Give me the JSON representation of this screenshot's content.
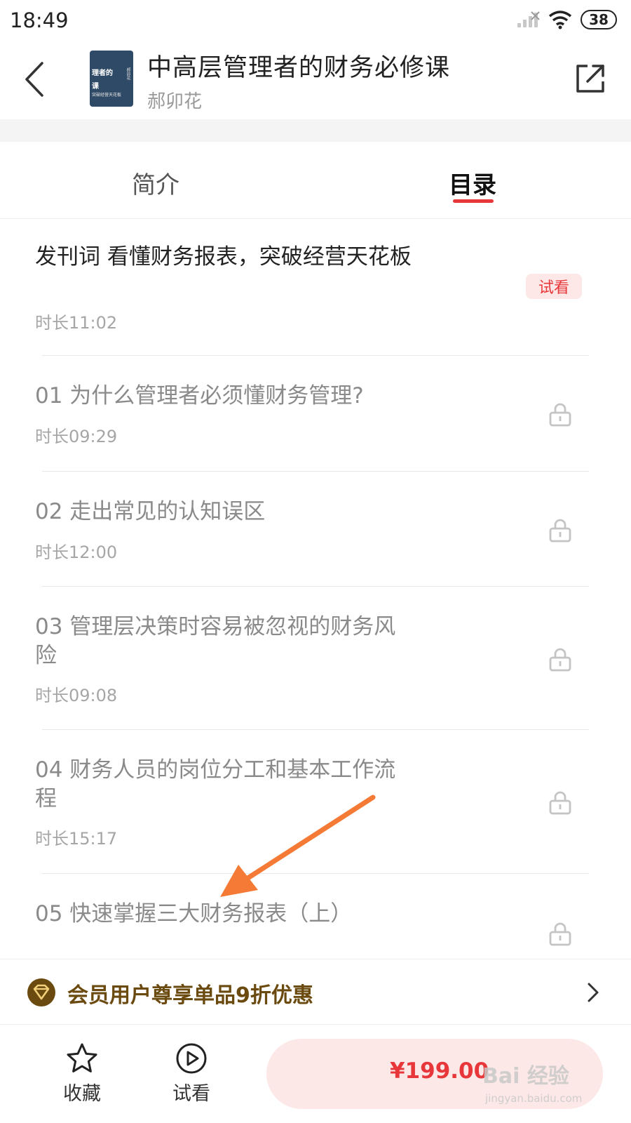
{
  "status_bar": {
    "time": "18:49",
    "battery": "38",
    "icons": [
      "signal-icon",
      "wifi-icon",
      "battery-icon"
    ]
  },
  "header": {
    "title": "中高层管理者的财务必修课",
    "author": "郝卯花",
    "cover": {
      "line1": "理者的",
      "line2": "课",
      "line3": "突破经营天花板",
      "author": "郝卯花"
    }
  },
  "tabs": [
    {
      "label": "简介",
      "active": false
    },
    {
      "label": "目录",
      "active": true
    }
  ],
  "lessons": [
    {
      "title": "发刊词 看懂财务报表，突破经营天花板",
      "duration": "时长11:02",
      "free": true,
      "badge": "试看"
    },
    {
      "title": "01 为什么管理者必须懂财务管理?",
      "duration": "时长09:29",
      "free": false
    },
    {
      "title": "02 走出常见的认知误区",
      "duration": "时长12:00",
      "free": false
    },
    {
      "title": "03 管理层决策时容易被忽视的财务风险",
      "duration": "时长09:08",
      "free": false
    },
    {
      "title": "04 财务人员的岗位分工和基本工作流程",
      "duration": "时长15:17",
      "free": false
    },
    {
      "title": "05 快速掌握三大财务报表（上）",
      "duration": "",
      "free": false
    }
  ],
  "member_promo": {
    "text": "会员用户尊享单品9折优惠"
  },
  "bottom_bar": {
    "favorite_label": "收藏",
    "trial_label": "试看",
    "price": "¥199.00"
  },
  "watermark": {
    "main": "Bai 经验",
    "url": "jingyan.baidu.com"
  },
  "colors": {
    "accent": "#e8373a",
    "member_gold": "#6b4a0f",
    "annotation_arrow": "#f47a35"
  }
}
